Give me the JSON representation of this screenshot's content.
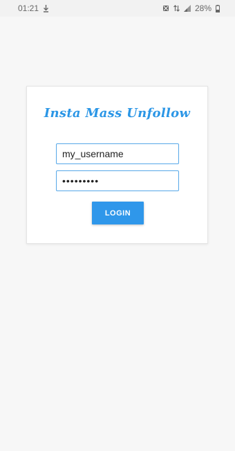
{
  "status_bar": {
    "time": "01:21",
    "battery": "28%",
    "icons": [
      "download-icon",
      "mute-icon",
      "data-icon",
      "signal-icon",
      "battery-icon"
    ]
  },
  "login_card": {
    "title": "Insta Mass Unfollow",
    "username_value": "my_username",
    "password_value": "•••••••••",
    "login_label": "LOGIN"
  },
  "colors": {
    "accent": "#2f97ea",
    "title": "#2b96e6",
    "field_border": "#55a7e8",
    "background": "#f7f7f7"
  }
}
